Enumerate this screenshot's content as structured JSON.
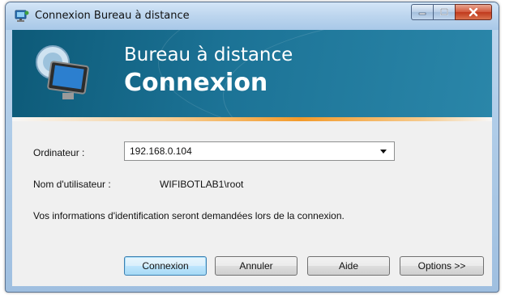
{
  "window": {
    "title": "Connexion Bureau à distance",
    "caption_buttons": [
      "minimize",
      "maximize",
      "close"
    ]
  },
  "banner": {
    "line1": "Bureau à distance",
    "line2": "Connexion",
    "icon": "remote-desktop-computer-icon"
  },
  "form": {
    "computer_label": "Ordinateur :",
    "computer_value": "192.168.0.104",
    "username_label": "Nom d'utilisateur :",
    "username_value": "WIFIBOTLAB1\\root",
    "info_text": "Vos informations d'identification seront demandées lors de la connexion."
  },
  "buttons": {
    "connect": "Connexion",
    "cancel": "Annuler",
    "help": "Aide",
    "options": "Options >>"
  },
  "colors": {
    "banner_dark": "#0d5a78",
    "banner_light": "#2a86a9",
    "accent_orange": "#f39a2a",
    "close_red": "#c0391c"
  }
}
